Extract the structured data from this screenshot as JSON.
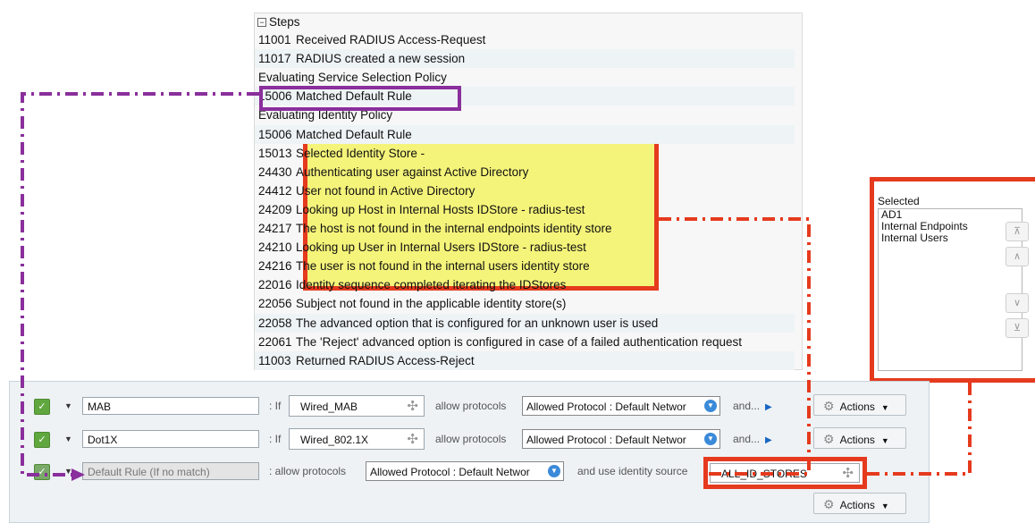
{
  "steps": {
    "header": "Steps",
    "items": [
      {
        "code": "11001",
        "text": "Received RADIUS Access-Request"
      },
      {
        "code": "11017",
        "text": "RADIUS created a new session"
      },
      {
        "code": "",
        "text": "Evaluating Service Selection Policy"
      },
      {
        "code": "15006",
        "text": "Matched Default Rule"
      },
      {
        "code": "",
        "text": "Evaluating Identity Policy"
      },
      {
        "code": "15006",
        "text": "Matched Default Rule"
      },
      {
        "code": "15013",
        "text": "Selected Identity Store -"
      },
      {
        "code": "24430",
        "text": "Authenticating user against Active Directory"
      },
      {
        "code": "24412",
        "text": "User not found in Active Directory"
      },
      {
        "code": "24209",
        "text": "Looking up Host in Internal Hosts IDStore - radius-test"
      },
      {
        "code": "24217",
        "text": "The host is not found in the internal endpoints identity store"
      },
      {
        "code": "24210",
        "text": "Looking up User in Internal Users IDStore - radius-test"
      },
      {
        "code": "24216",
        "text": "The user is not found in the internal users identity store"
      },
      {
        "code": "22016",
        "text": "Identity sequence completed iterating the IDStores"
      },
      {
        "code": "22056",
        "text": "Subject not found in the applicable identity store(s)"
      },
      {
        "code": "22058",
        "text": "The advanced option that is configured for an unknown user is used"
      },
      {
        "code": "22061",
        "text": "The 'Reject' advanced option is configured in case of a failed authentication request"
      },
      {
        "code": "11003",
        "text": "Returned RADIUS Access-Reject"
      }
    ]
  },
  "selected": {
    "label": "Selected",
    "items": [
      "AD1",
      "Internal Endpoints",
      "Internal Users"
    ]
  },
  "rules": {
    "if_label": ": If",
    "allow_label": "allow protocols",
    "and_label": "and...",
    "actions_label": "Actions",
    "rows": [
      {
        "name": "MAB",
        "condition": "Wired_MAB",
        "protocol": "Allowed Protocol : Default Networ"
      },
      {
        "name": "Dot1X",
        "condition": "Wired_802.1X",
        "protocol": "Allowed Protocol : Default Networ"
      }
    ],
    "default": {
      "name": "Default Rule (If no match)",
      "allow_label": ": allow protocols",
      "protocol": "Allowed Protocol : Default Networ",
      "use_label": "and use identity source",
      "identity_source": "ALL_ID_STORES"
    }
  },
  "colors": {
    "red_highlight": "#e53a1e",
    "purple_highlight": "#8a2f9c",
    "yellow_fill": "#f5f47a"
  }
}
